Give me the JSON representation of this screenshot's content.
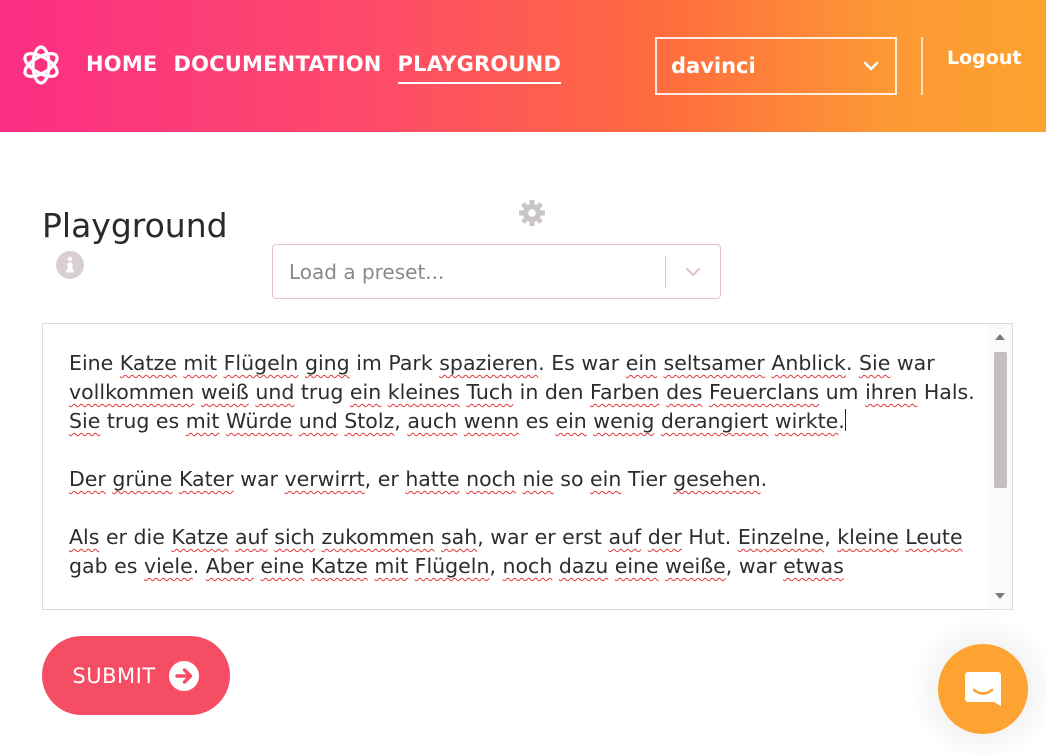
{
  "header": {
    "nav": [
      {
        "label": "HOME",
        "active": false
      },
      {
        "label": "DOCUMENTATION",
        "active": false
      },
      {
        "label": "PLAYGROUND",
        "active": true
      }
    ],
    "model": {
      "selected": "davinci"
    },
    "logout_label": "Logout",
    "colors": {
      "gradient_start": "#fb2e85",
      "gradient_end": "#fca32f"
    }
  },
  "main": {
    "title": "Playground",
    "preset": {
      "placeholder": "Load a preset..."
    },
    "editor": {
      "paragraphs": [
        "Eine Katze mit Flügeln ging im Park spazieren. Es war ein seltsamer Anblick. Sie war vollkommen weiß und trug ein kleines Tuch in den Farben des Feuerclans um ihren Hals. Sie trug es mit Würde und Stolz, auch wenn es ein wenig derangiert wirkte.",
        "Der grüne Kater war verwirrt, er hatte noch nie so ein Tier gesehen.",
        "Als er die Katze auf sich zukommen sah, war er erst auf der Hut. Einzelne, kleine Leute gab es viele. Aber eine Katze mit Flügeln, noch dazu eine weiße, war etwas"
      ]
    },
    "submit_label": "SUBMIT"
  },
  "icons": [
    "openai-logo-icon",
    "chevron-down-icon",
    "info-icon",
    "gear-icon",
    "arrow-right-circle-icon",
    "chat-icon"
  ],
  "accent": {
    "submit": "#f54d63",
    "chat": "#fca331"
  }
}
